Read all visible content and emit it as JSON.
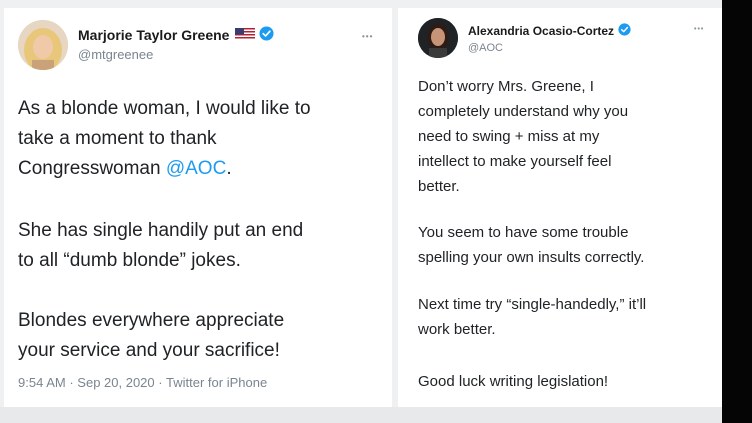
{
  "left_tweet": {
    "display_name": "Marjorie Taylor Greene",
    "handle": "@mtgreenee",
    "more_label": "•••",
    "body_paragraphs": [
      [
        "As a blonde woman, I would like to",
        "take a moment to thank",
        "Congresswoman "
      ],
      [
        "She has single handily put an end",
        "to all “dumb blonde” jokes."
      ],
      [
        "Blondes everywhere appreciate",
        "your service and your sacrifice!"
      ]
    ],
    "mention": "@AOC",
    "mention_suffix": ".",
    "time": "9:54 AM",
    "separator": "·",
    "date": "Sep 20, 2020",
    "source": "Twitter for iPhone"
  },
  "right_tweet": {
    "display_name": "Alexandria Ocasio-Cortez",
    "handle": "@AOC",
    "more_label": "•••",
    "body_lines": [
      "Don’t worry Mrs. Greene, I",
      "completely understand why you",
      "need to swing + miss at my",
      "intellect to make yourself feel",
      "better.",
      "You seem to have some trouble",
      "spelling your own insults correctly.",
      "Next time try “single-handedly,” it’ll",
      "work better.",
      "Good luck writing legislation!"
    ]
  },
  "colors": {
    "verified": "#1d9bf0",
    "mention": "#1d9bf0",
    "text": "#202326",
    "muted": "#7a8590"
  },
  "icons": [
    "verified-badge-icon",
    "us-flag-icon",
    "more-options-icon"
  ]
}
